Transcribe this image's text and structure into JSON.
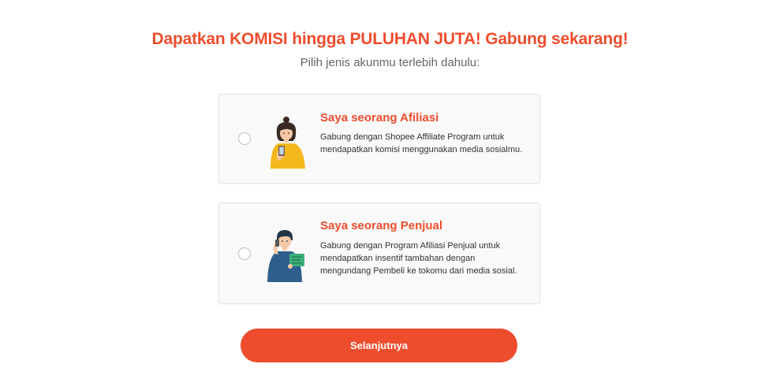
{
  "header": {
    "headline": "Dapatkan KOMISI hingga PULUHAN JUTA! Gabung sekarang!",
    "subheadline": "Pilih jenis akunmu terlebih dahulu:"
  },
  "options": [
    {
      "title": "Saya seorang Afiliasi",
      "description": "Gabung dengan Shopee Affiliate Program untuk mendapatkan komisi menggunakan media sosialmu.",
      "illustration": "affiliate-woman-with-phone-icon",
      "selected": false
    },
    {
      "title": "Saya seorang Penjual",
      "description": "Gabung dengan Program Afiliasi Penjual untuk mendapatkan insentif tambahan dengan mengundang Pembeli ke tokomu dari media sosial.",
      "illustration": "seller-man-with-phone-icon",
      "selected": false
    }
  ],
  "next_button": {
    "label": "Selanjutnya"
  },
  "colors": {
    "accent": "#ee4d2d",
    "card_bg": "#f9f9f9",
    "card_border": "#e3e3e3"
  }
}
